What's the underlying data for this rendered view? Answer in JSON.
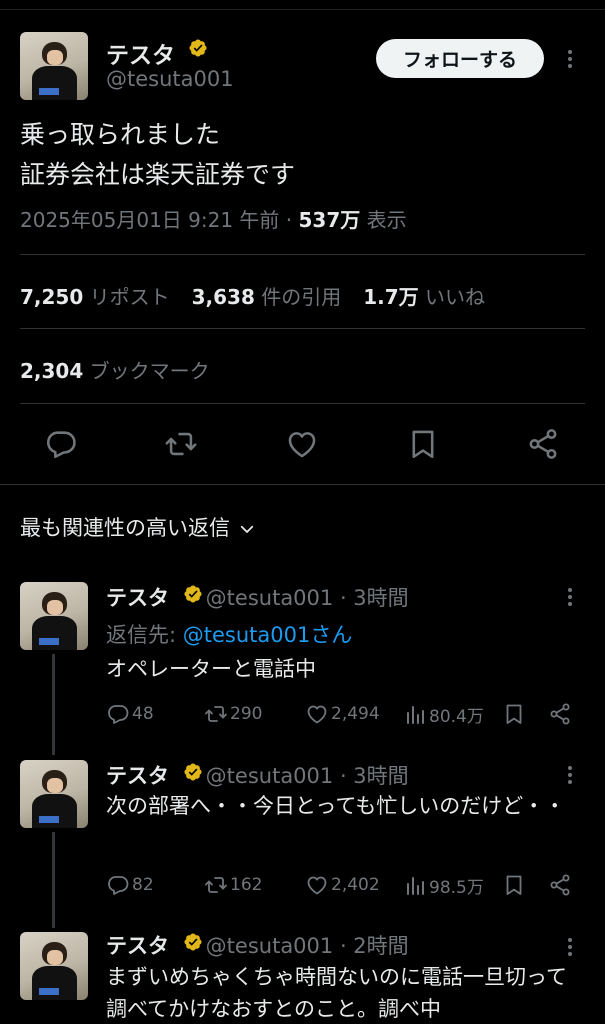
{
  "author": {
    "name": "テスタ",
    "handle": "@tesuta001",
    "verified_color": "#e2b719"
  },
  "follow_label": "フォローする",
  "tweet": {
    "line1": "乗っ取られました",
    "line2": "証券会社は楽天証券です",
    "timestamp": "2025年05月01日 9:21 午前 · ",
    "views": "537万",
    "views_label": " 表示"
  },
  "stats": {
    "reposts": "7,250",
    "reposts_label": " リポスト",
    "quotes": "3,638",
    "quotes_label": " 件の引用",
    "likes": "1.7万",
    "likes_label": " いいね",
    "bookmarks": "2,304",
    "bookmarks_label": " ブックマーク"
  },
  "actions": [
    "reply-icon",
    "repost-icon",
    "like-icon",
    "bookmark-icon",
    "share-icon"
  ],
  "sort_label": "最も関連性の高い返信",
  "replies": [
    {
      "name": "テスタ",
      "handle_time": " @tesuta001 · 3時間",
      "reply_to_prefix": "返信先: ",
      "reply_to_handle": "@tesuta001さん",
      "text": "オペレーターと電話中",
      "comments": "48",
      "reposts": "290",
      "likes": "2,494",
      "views": "80.4万"
    },
    {
      "name": "テスタ",
      "handle_time": " @tesuta001 · 3時間",
      "text": "次の部署へ・・今日とっても忙しいのだけど・・",
      "comments": "82",
      "reposts": "162",
      "likes": "2,402",
      "views": "98.5万"
    },
    {
      "name": "テスタ",
      "handle_time": " @tesuta001 · 2時間",
      "text": "まずいめちゃくちゃ時間ないのに電話一旦切って調べてかけなおすとのこと。調べ中"
    }
  ],
  "colors": {
    "background": "#000000",
    "text": "#e7e9ea",
    "muted": "#71767b",
    "link": "#1d9bf0",
    "divider": "#2f3336"
  }
}
